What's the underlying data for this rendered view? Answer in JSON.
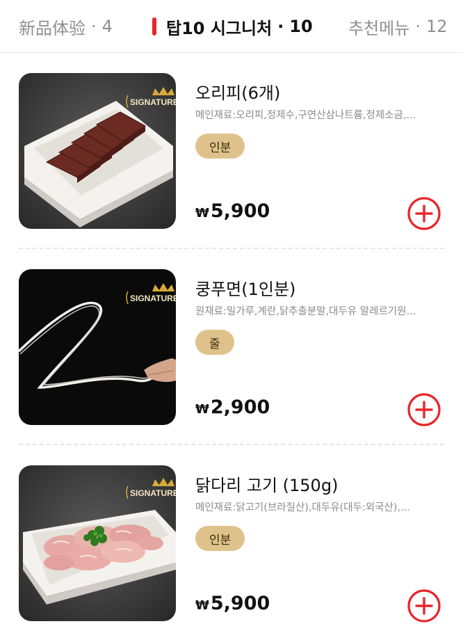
{
  "tabs": [
    {
      "label": "新品体验",
      "count": "4",
      "active": false
    },
    {
      "label": "탑10 시그니처",
      "count": "10",
      "active": true
    },
    {
      "label": "추천메뉴",
      "count": "12",
      "active": false
    }
  ],
  "tab_separator": "·",
  "items": [
    {
      "name": "오리피(6개)",
      "desc": "메인재료:오리피,정제수,구연산삼나트륨,정제소금,...",
      "unit": "인분",
      "currency": "₩",
      "price": "5,900",
      "badge": "SIGNATURE"
    },
    {
      "name": "쿵푸면(1인분)",
      "desc": "원재료:밀가루,계란,닭추출분말,대두유 알레르기원...",
      "unit": "줄",
      "currency": "₩",
      "price": "2,900",
      "badge": "SIGNATURE"
    },
    {
      "name": "닭다리 고기 (150g)",
      "desc": "메인재료:닭고기(브라질산),대두유(대두:외국산),...",
      "unit": "인분",
      "currency": "₩",
      "price": "5,900",
      "badge": "SIGNATURE"
    }
  ],
  "colors": {
    "accent": "#e8262b",
    "unit_pill": "#dfc28b",
    "badge_gold": "#d9a93a"
  }
}
